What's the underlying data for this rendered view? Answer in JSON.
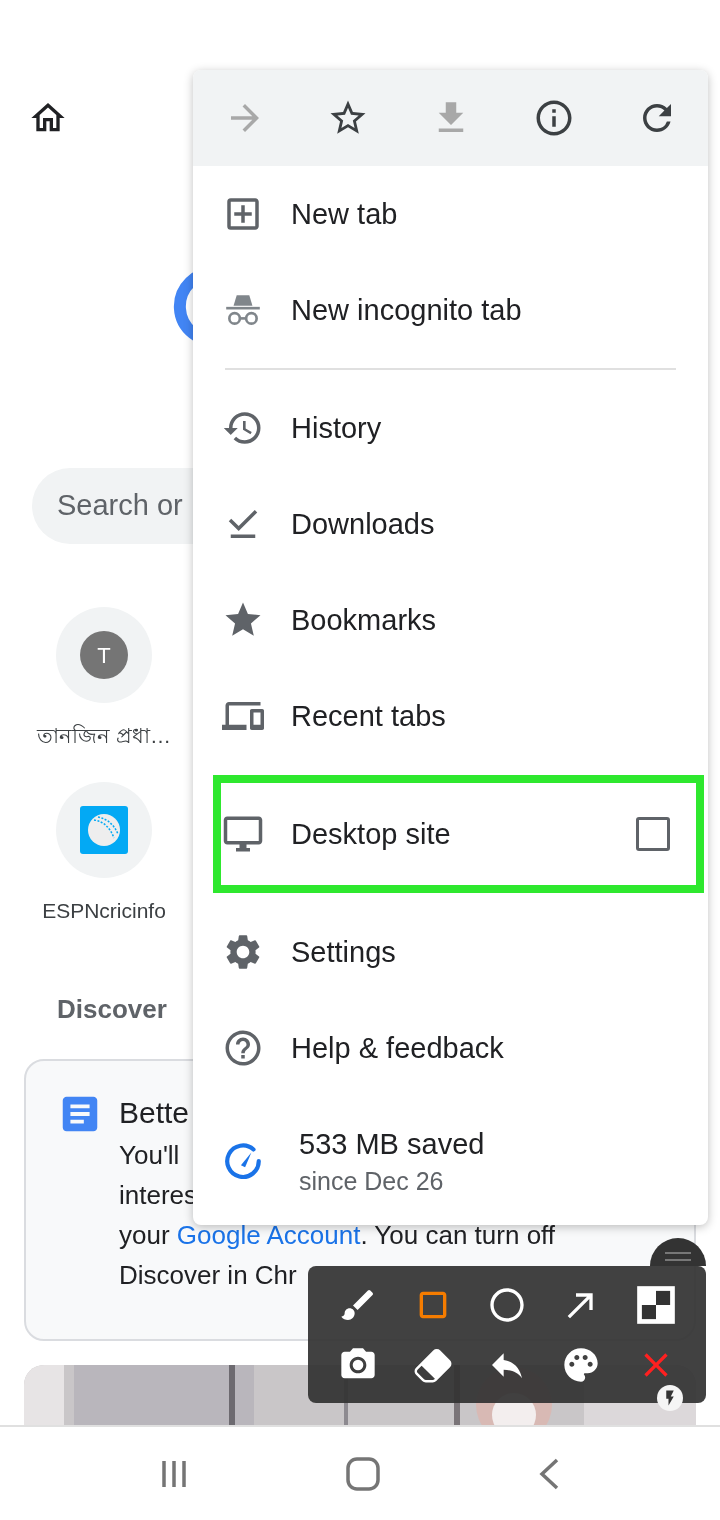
{
  "page": {
    "search": {
      "placeholder": "Search or"
    },
    "tiles": [
      {
        "kind": "letter",
        "letter": "T",
        "label": "তানজিন প্রধা…"
      },
      {
        "kind": "cricket",
        "label": "ESPNcricinfo"
      }
    ],
    "discover_label": "Discover",
    "card": {
      "title": "Bette",
      "lines": [
        {
          "text": "You'll"
        },
        {
          "text": "interes"
        },
        {
          "text": "your ",
          "link": "Google Account",
          "after": ". You can turn off"
        },
        {
          "text": "Discover in Chr"
        }
      ]
    }
  },
  "menu": {
    "toolbar": [
      {
        "kind": "forward",
        "disabled": true
      },
      {
        "kind": "star",
        "disabled": false
      },
      {
        "kind": "download",
        "disabled": true
      },
      {
        "kind": "info",
        "disabled": false
      },
      {
        "kind": "reload",
        "disabled": false
      }
    ],
    "groups": [
      [
        {
          "kind": "new-tab",
          "label": "New tab",
          "highlighted": false
        },
        {
          "kind": "incognito",
          "label": "New incognito tab",
          "highlighted": false
        }
      ],
      [
        {
          "kind": "history",
          "label": "History",
          "highlighted": false
        },
        {
          "kind": "downloads",
          "label": "Downloads",
          "highlighted": false
        },
        {
          "kind": "bookmarks",
          "label": "Bookmarks",
          "highlighted": false
        },
        {
          "kind": "recent-tabs",
          "label": "Recent tabs",
          "highlighted": false
        },
        {
          "kind": "desktop-site",
          "label": "Desktop site",
          "highlighted": true,
          "checked": false
        },
        {
          "kind": "settings",
          "label": "Settings",
          "highlighted": false
        },
        {
          "kind": "help",
          "label": "Help & feedback",
          "highlighted": false
        },
        {
          "kind": "data-saver",
          "label": "533 MB saved",
          "sublabel": "since Dec 26",
          "highlighted": false
        }
      ]
    ]
  },
  "annotation_toolbar": {
    "tools": [
      {
        "kind": "brush",
        "selected": false
      },
      {
        "kind": "rectangle",
        "selected": true
      },
      {
        "kind": "circle",
        "selected": false
      },
      {
        "kind": "arrow",
        "selected": false
      },
      {
        "kind": "mosaic",
        "selected": false
      },
      {
        "kind": "camera",
        "selected": false
      },
      {
        "kind": "eraser",
        "selected": false
      },
      {
        "kind": "undo",
        "selected": false
      },
      {
        "kind": "palette",
        "selected": false
      },
      {
        "kind": "close",
        "selected": false
      }
    ]
  }
}
